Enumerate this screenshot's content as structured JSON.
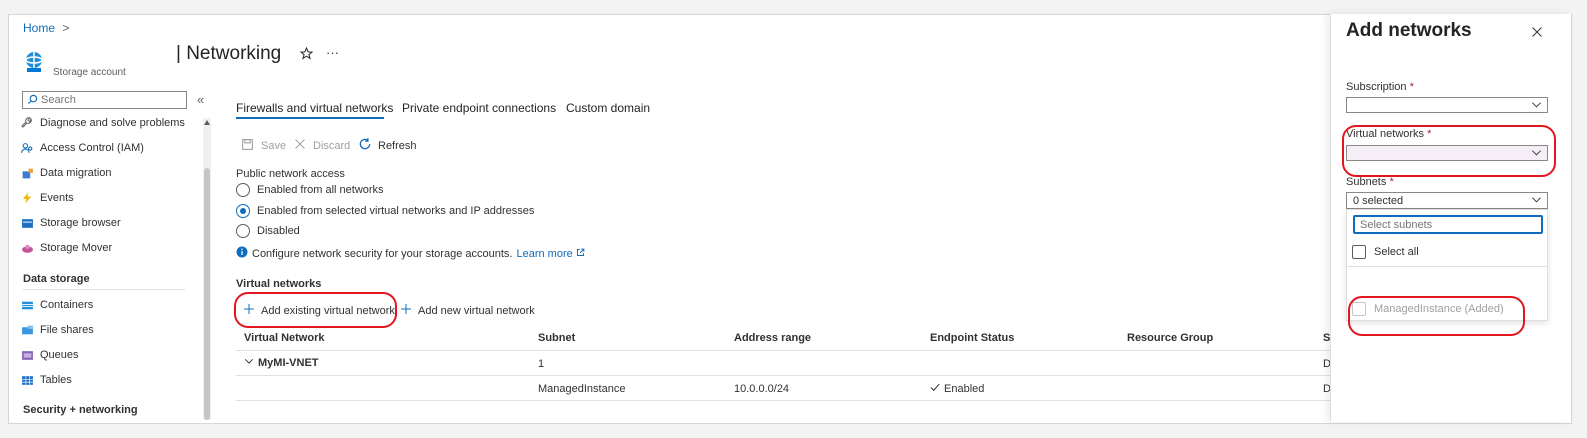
{
  "breadcrumb": {
    "home": "Home",
    "sep": ">"
  },
  "header": {
    "title": "| Networking",
    "subtitle": "Storage account",
    "more": "···"
  },
  "sidebar": {
    "search_placeholder": "Search",
    "collapse": "«",
    "items_top": [
      {
        "label": "Diagnose and solve problems",
        "icon": "wrench-icon"
      },
      {
        "label": "Access Control (IAM)",
        "icon": "people-icon"
      },
      {
        "label": "Data migration",
        "icon": "migration-icon"
      },
      {
        "label": "Events",
        "icon": "bolt-icon"
      },
      {
        "label": "Storage browser",
        "icon": "storage-browser-icon"
      },
      {
        "label": "Storage Mover",
        "icon": "storage-mover-icon"
      }
    ],
    "section_data_storage": "Data storage",
    "items_data": [
      {
        "label": "Containers",
        "icon": "containers-icon"
      },
      {
        "label": "File shares",
        "icon": "file-shares-icon"
      },
      {
        "label": "Queues",
        "icon": "queues-icon"
      },
      {
        "label": "Tables",
        "icon": "tables-icon"
      }
    ],
    "section_security": "Security + networking"
  },
  "tabs": [
    "Firewalls and virtual networks",
    "Private endpoint connections",
    "Custom domain"
  ],
  "toolbar": {
    "save": "Save",
    "discard": "Discard",
    "refresh": "Refresh"
  },
  "public_access": {
    "label": "Public network access",
    "options": [
      "Enabled from all networks",
      "Enabled from selected virtual networks and IP addresses",
      "Disabled"
    ],
    "selected": 1,
    "info": "Configure network security for your storage accounts.",
    "learn_more": "Learn more"
  },
  "vnets": {
    "heading": "Virtual networks",
    "add_existing": "Add existing virtual network",
    "add_new": "Add new virtual network",
    "columns": [
      "Virtual Network",
      "Subnet",
      "Address range",
      "Endpoint Status",
      "Resource Group",
      "S"
    ],
    "group": {
      "name": "MyMI-VNET",
      "subnet_count": "1",
      "last": "D"
    },
    "row": {
      "subnet": "ManagedInstance",
      "address": "10.0.0.0/24",
      "status": "Enabled",
      "last": "D"
    }
  },
  "panel": {
    "title": "Add networks",
    "subscription_label": "Subscription",
    "vnet_label": "Virtual networks",
    "subnets_label": "Subnets",
    "subnets_value": "0 selected",
    "subnets_search_placeholder": "Select subnets",
    "select_all": "Select all",
    "managed_instance": "ManagedInstance (Added)",
    "required_mark": "*"
  },
  "colors": {
    "accent": "#0f6cbd",
    "highlight": "#e3151e",
    "vnet_field_bg": "#f6eef6"
  }
}
